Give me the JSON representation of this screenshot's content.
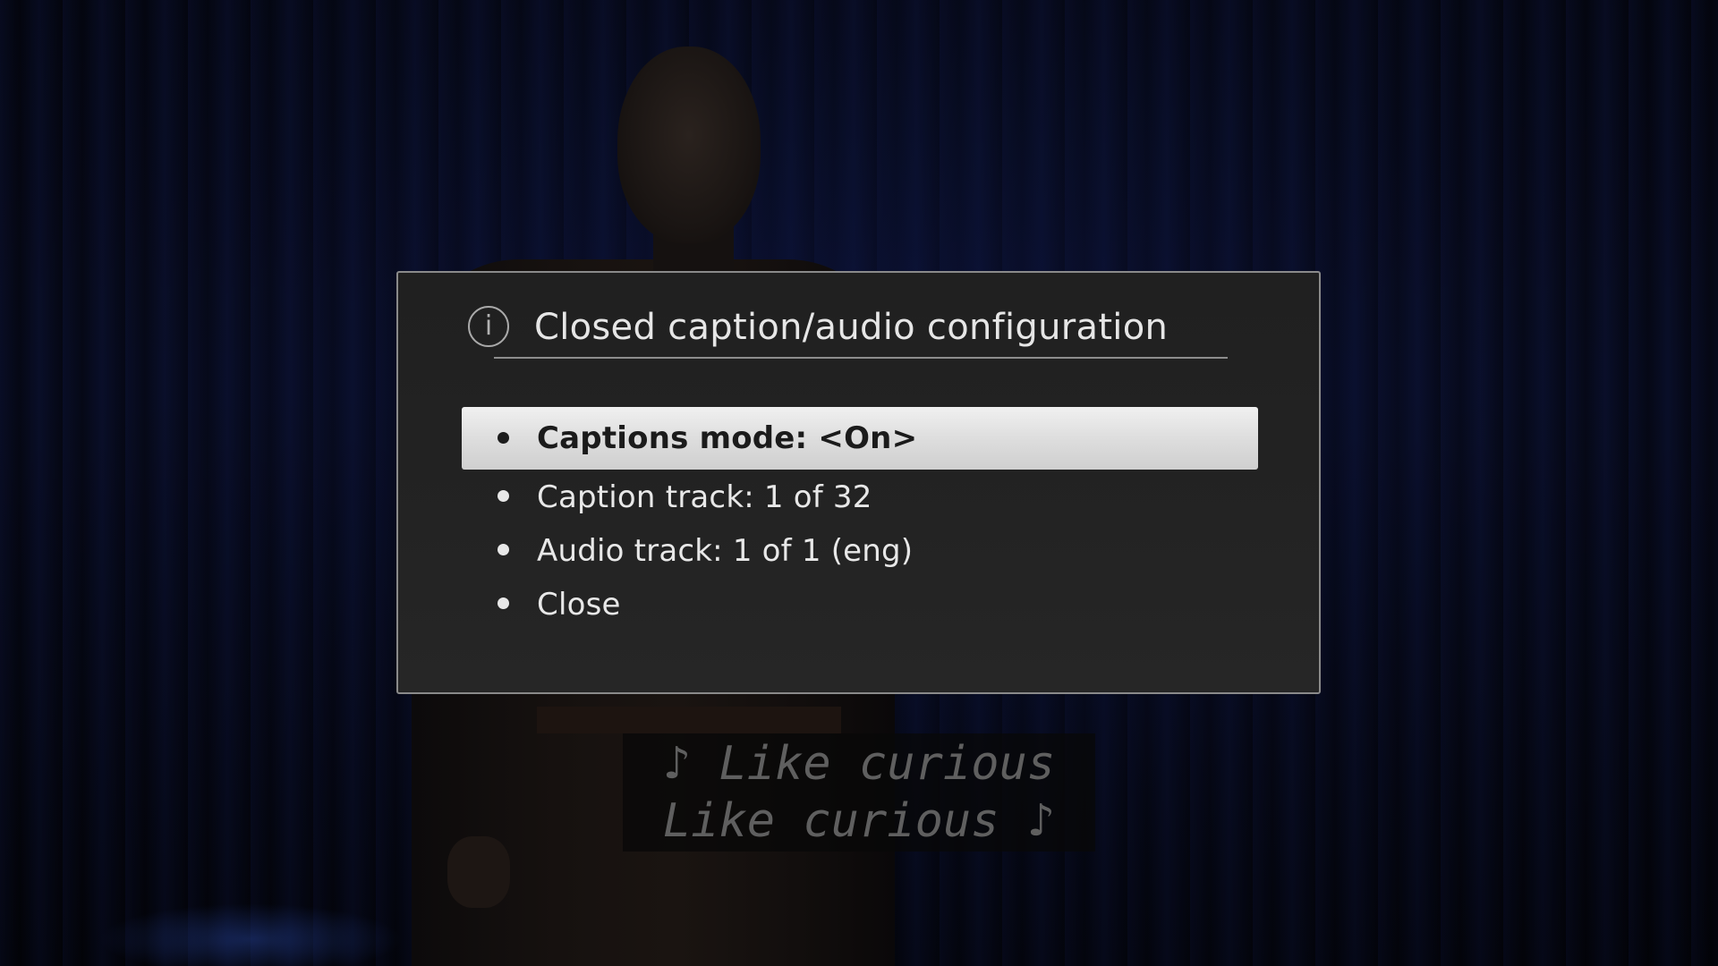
{
  "dialog": {
    "title": "Closed caption/audio configuration",
    "icon": "info-icon",
    "info_glyph": "i",
    "menu": [
      {
        "label": "Captions mode: <On>",
        "selected": true
      },
      {
        "label": "Caption track: 1 of 32",
        "selected": false
      },
      {
        "label": "Audio track: 1 of 1 (eng)",
        "selected": false
      },
      {
        "label": "Close",
        "selected": false
      }
    ]
  },
  "captions": {
    "line1": "♪ Like curious",
    "line2": "Like curious ♪"
  },
  "colors": {
    "dialog_background": "#222222",
    "selection_highlight": "#dcdcdc",
    "text": "#e8e8e8"
  }
}
